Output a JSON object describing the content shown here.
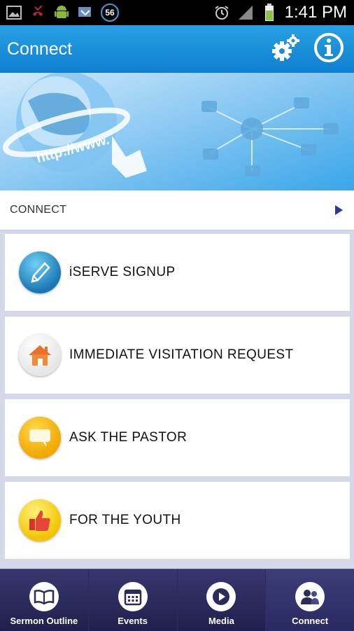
{
  "status_bar": {
    "time": "1:41 PM",
    "badge": "56",
    "icons": [
      "image-icon",
      "missed-call-icon",
      "android-icon",
      "sync-icon",
      "alarm-icon",
      "signal-icon",
      "battery-icon"
    ]
  },
  "header": {
    "title": "Connect",
    "actions": [
      "settings-gear-icon",
      "info-icon"
    ]
  },
  "banner": {
    "text": "http://www."
  },
  "section": {
    "title": "CONNECT"
  },
  "list": {
    "items": [
      {
        "label": "iSERVE SIGNUP",
        "icon": "pen-icon"
      },
      {
        "label": "IMMEDIATE VISITATION REQUEST",
        "icon": "home-icon"
      },
      {
        "label": "ASK THE PASTOR",
        "icon": "speech-bubble-icon"
      },
      {
        "label": "FOR THE YOUTH",
        "icon": "thumbs-up-icon"
      }
    ]
  },
  "bottom_nav": {
    "items": [
      {
        "label": "Sermon Outline",
        "icon": "book-icon"
      },
      {
        "label": "Events",
        "icon": "calendar-icon"
      },
      {
        "label": "Media",
        "icon": "play-icon"
      },
      {
        "label": "Connect",
        "icon": "people-icon",
        "active": true
      }
    ]
  },
  "colors": {
    "header": "#1a8fd9",
    "nav": "#2b2b5e",
    "list_bg": "#d7d7ea",
    "arrow": "#2a3a8e"
  }
}
